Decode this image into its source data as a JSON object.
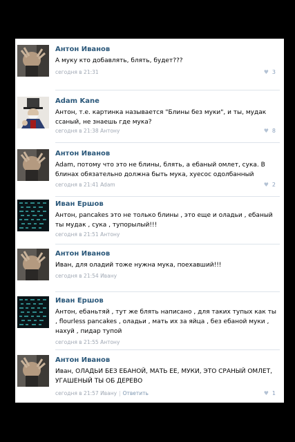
{
  "comments": [
    {
      "author": "Антон Иванов",
      "avatar": "anton",
      "text": "А муку кто добавлять, блять, будет???",
      "time": "сегодня в 21:31",
      "reply_to": "",
      "likes": "3"
    },
    {
      "author": "Adam Kane",
      "avatar": "adam",
      "text": "Антон, т.е. картинка называется \"Блины без муки\", и ты, мудак ссаный, не знаешь где мука?",
      "time": "сегодня в 21:38",
      "reply_to": "Антону",
      "likes": "8"
    },
    {
      "author": "Антон Иванов",
      "avatar": "anton",
      "text": "Adam, потому что это не блины, блять, а ебаный омлет, сука. В блинах обязательно должна быть мука, хуесос одолбанный",
      "time": "сегодня в 21:41",
      "reply_to": "Adam",
      "likes": "2"
    },
    {
      "author": "Иван Ершов",
      "avatar": "ivan",
      "text": "Антон, pancakes это не только блины , это еще и оладьи , ебаный ты мудак , сука , тупорылый!!!",
      "time": "сегодня в 21:51",
      "reply_to": "Антону",
      "likes": ""
    },
    {
      "author": "Антон Иванов",
      "avatar": "anton",
      "text": "Иван, для оладий тоже нужна мука, поехавший!!!",
      "time": "сегодня в 21:54",
      "reply_to": "Ивану",
      "likes": ""
    },
    {
      "author": "Иван Ершов",
      "avatar": "ivan",
      "text": "Антон, ебаньтяй , тут же блять написано , для таких тупых как ты , flourless pancakes , оладьи , мать их за яйца , без ебаной муки , нахуй , пидар тупой",
      "time": "сегодня в 21:55",
      "reply_to": "Антону",
      "likes": ""
    },
    {
      "author": "Антон Иванов",
      "avatar": "anton",
      "text": "Иван, ОЛАДЬИ БЕЗ ЕБАНОЙ, МАТЬ ЕЕ, МУКИ, ЭТО СРАНЫЙ ОМЛЕТ, УГАШЕНЫЙ ТЫ ОБ ДЕРЕВО",
      "time": "сегодня в 21:57",
      "reply_to": "Ивану",
      "reply_label": "Ответить",
      "likes": "1"
    }
  ],
  "colors": {
    "author": "#2b587a",
    "meta": "#a0a8b4",
    "background": "#000000"
  }
}
